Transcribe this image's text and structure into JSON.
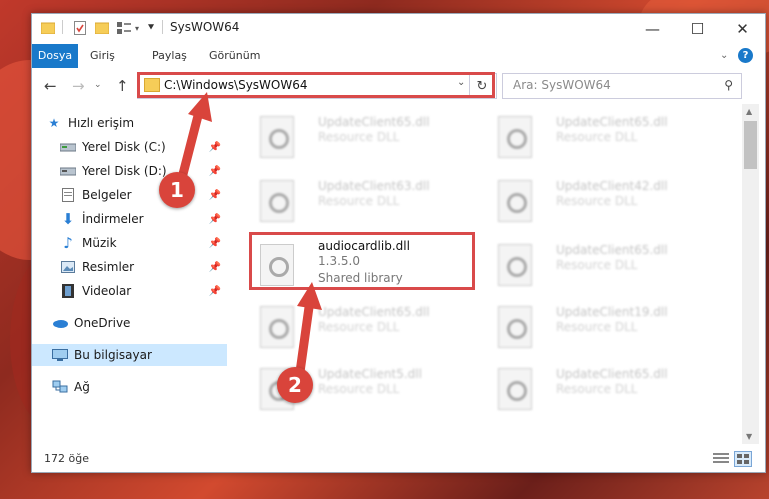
{
  "title": "SysWOW64",
  "ribbon_tabs": [
    "Dosya",
    "Giriş",
    "Paylaş",
    "Görünüm"
  ],
  "address": "C:\\Windows\\SysWOW64",
  "search_placeholder": "Ara: SysWOW64",
  "sidebar": {
    "quick_access": "Hızlı erişim",
    "items": [
      {
        "label": "Yerel Disk (C:)",
        "icon": "drive-icon"
      },
      {
        "label": "Yerel Disk (D:)",
        "icon": "drive-icon"
      },
      {
        "label": "Belgeler",
        "icon": "documents-icon"
      },
      {
        "label": "İndirmeler",
        "icon": "downloads-icon"
      },
      {
        "label": "Müzik",
        "icon": "music-icon"
      },
      {
        "label": "Resimler",
        "icon": "pictures-icon"
      },
      {
        "label": "Videolar",
        "icon": "videos-icon"
      }
    ],
    "onedrive": "OneDrive",
    "this_pc": "Bu bilgisayar",
    "network": "Ağ"
  },
  "files": [
    {
      "name": "UpdateClient65.dll",
      "type": "Resource DLL"
    },
    {
      "name": "UpdateClient65.dll",
      "type": "Resource DLL"
    },
    {
      "name": "UpdateClient63.dll",
      "type": "Resource DLL"
    },
    {
      "name": "UpdateClient42.dll",
      "type": "Resource DLL"
    },
    {
      "name": "audiocardlib.dll",
      "version": "1.3.5.0",
      "type": "Shared library"
    },
    {
      "name": "UpdateClient65.dll",
      "type": "Resource DLL"
    },
    {
      "name": "UpdateClient65.dll",
      "type": "Resource DLL"
    },
    {
      "name": "UpdateClient19.dll",
      "type": "Resource DLL"
    },
    {
      "name": "UpdateClient5.dll",
      "type": "Resource DLL"
    },
    {
      "name": "UpdateClient65.dll",
      "type": "Resource DLL"
    }
  ],
  "status": "172 öğe",
  "callouts": [
    "1",
    "2"
  ],
  "colors": {
    "accent": "#1979ca",
    "highlight": "#d94a4a",
    "selected": "#cce8ff"
  }
}
